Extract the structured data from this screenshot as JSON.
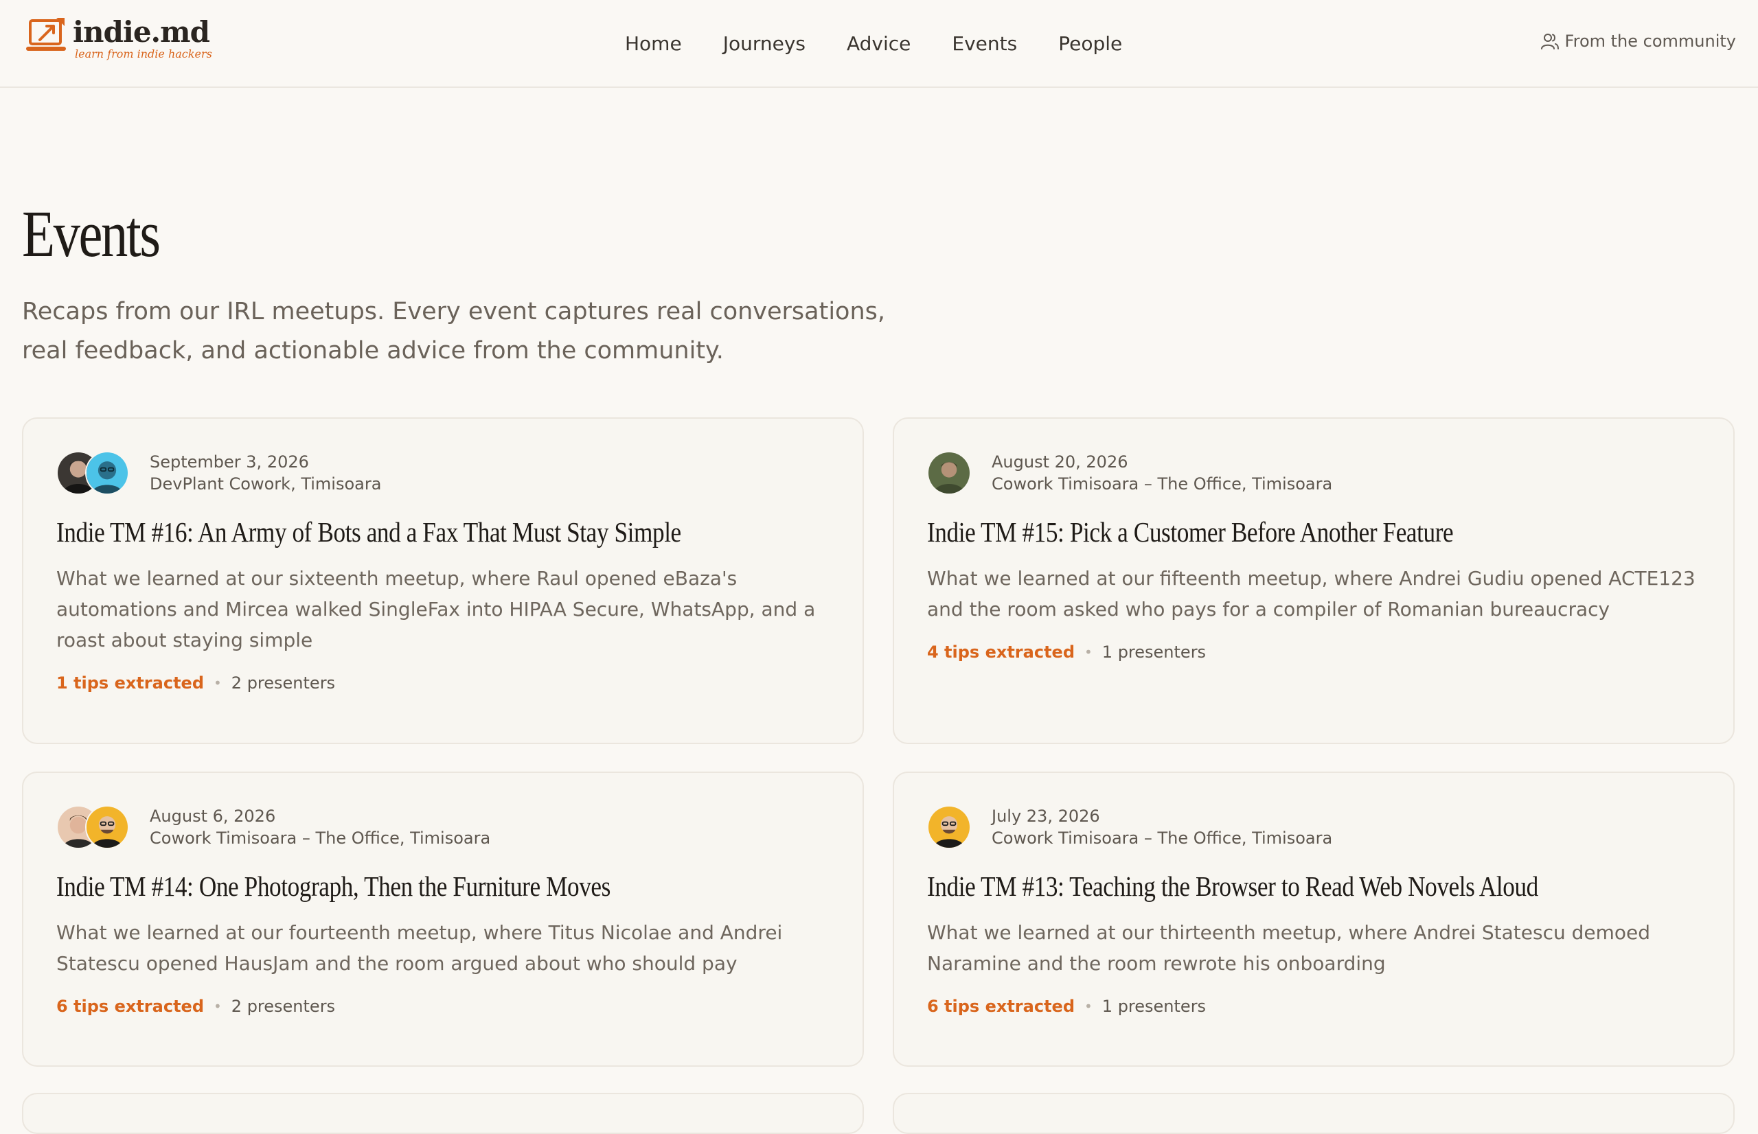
{
  "site": {
    "name": "indie.md",
    "tagline": "learn from indie hackers",
    "accent_color": "#d9651c",
    "logo_icon": "laptop-rocket-icon"
  },
  "nav": {
    "items": [
      {
        "label": "Home"
      },
      {
        "label": "Journeys"
      },
      {
        "label": "Advice"
      },
      {
        "label": "Events"
      },
      {
        "label": "People"
      }
    ],
    "community_label": "From the community",
    "community_icon": "users-icon"
  },
  "hero": {
    "title": "Events",
    "subtitle": "Recaps from our IRL meetups. Every event captures real conversations, real feedback, and actionable advice from the community."
  },
  "events": [
    {
      "date": "September 3, 2026",
      "location": "DevPlant Cowork, Timisoara",
      "title": "Indie TM #16: An Army of Bots and a Fax That Must Stay Simple",
      "description": "What we learned at our sixteenth meetup, where Raul opened eBaza's automations and Mircea walked SingleFax into HIPAA Secure, WhatsApp, and a roast about staying simple",
      "tips": "1 tips extracted",
      "presenters": "2 presenters"
    },
    {
      "date": "August 20, 2026",
      "location": "Cowork Timisoara – The Office, Timisoara",
      "title": "Indie TM #15: Pick a Customer Before Another Feature",
      "description": "What we learned at our fifteenth meetup, where Andrei Gudiu opened ACTE123 and the room asked who pays for a compiler of Romanian bureaucracy",
      "tips": "4 tips extracted",
      "presenters": "1 presenters"
    },
    {
      "date": "August 6, 2026",
      "location": "Cowork Timisoara – The Office, Timisoara",
      "title": "Indie TM #14: One Photograph, Then the Furniture Moves",
      "description": "What we learned at our fourteenth meetup, where Titus Nicolae and Andrei Statescu opened HausJam and the room argued about who should pay",
      "tips": "6 tips extracted",
      "presenters": "2 presenters"
    },
    {
      "date": "July 23, 2026",
      "location": "Cowork Timisoara – The Office, Timisoara",
      "title": "Indie TM #13: Teaching the Browser to Read Web Novels Aloud",
      "description": "What we learned at our thirteenth meetup, where Andrei Statescu demoed Naramine and the room rewrote his onboarding",
      "tips": "6 tips extracted",
      "presenters": "1 presenters"
    }
  ]
}
